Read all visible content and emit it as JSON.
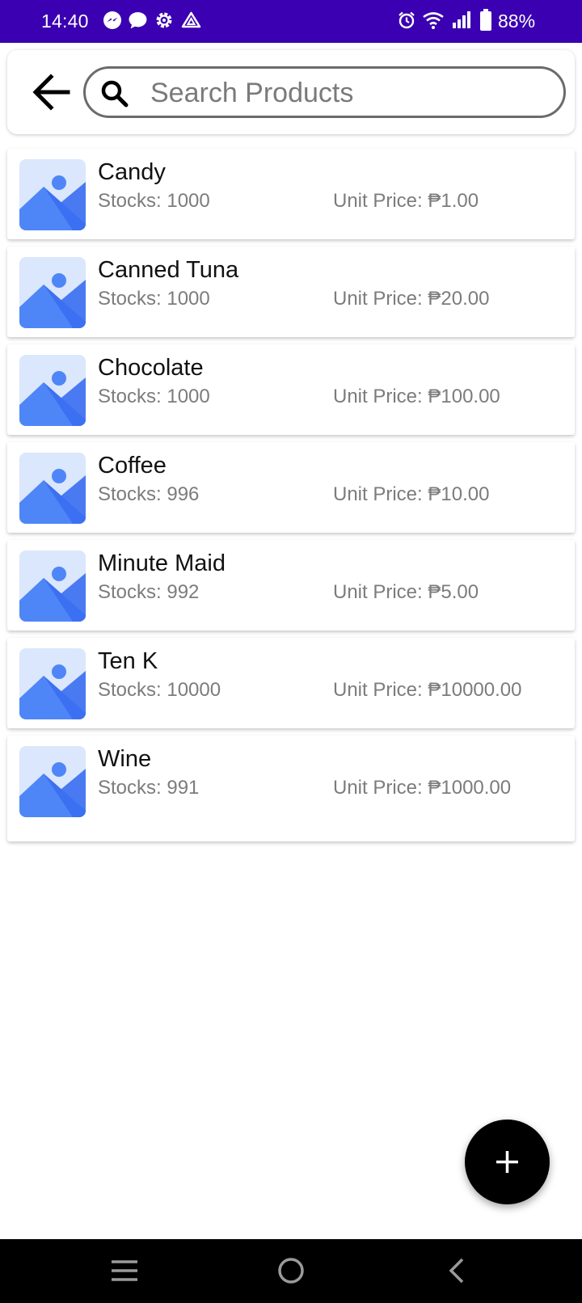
{
  "status_bar": {
    "time": "14:40",
    "battery": "88%",
    "left_icons": [
      "messenger-icon",
      "chat-bubble-icon",
      "settings-gear-icon",
      "drive-icon"
    ],
    "right_icons": [
      "alarm-icon",
      "wifi-icon",
      "signal-icon",
      "battery-icon"
    ],
    "background": "#3a00b1"
  },
  "header": {
    "back_icon": "arrow-left-icon",
    "search_placeholder": "Search Products",
    "search_value": ""
  },
  "products": [
    {
      "name": "Candy",
      "stocks": "Stocks: 1000",
      "price": "Unit Price: ₱1.00"
    },
    {
      "name": "Canned Tuna",
      "stocks": "Stocks: 1000",
      "price": "Unit Price: ₱20.00"
    },
    {
      "name": "Chocolate",
      "stocks": "Stocks: 1000",
      "price": "Unit Price: ₱100.00"
    },
    {
      "name": "Coffee",
      "stocks": "Stocks: 996",
      "price": "Unit Price: ₱10.00"
    },
    {
      "name": "Minute Maid",
      "stocks": "Stocks: 992",
      "price": "Unit Price: ₱5.00"
    },
    {
      "name": "Ten K",
      "stocks": "Stocks: 10000",
      "price": "Unit Price: ₱10000.00"
    },
    {
      "name": "Wine",
      "stocks": "Stocks: 991",
      "price": "Unit Price: ₱1000.00"
    }
  ],
  "fab": {
    "icon": "plus-icon"
  },
  "nav_bar": {
    "icons": [
      "menu-icon",
      "home-circle-icon",
      "back-chevron-icon"
    ]
  },
  "colors": {
    "accent": "#3a00b1",
    "image_placeholder": "#4f86f7"
  }
}
